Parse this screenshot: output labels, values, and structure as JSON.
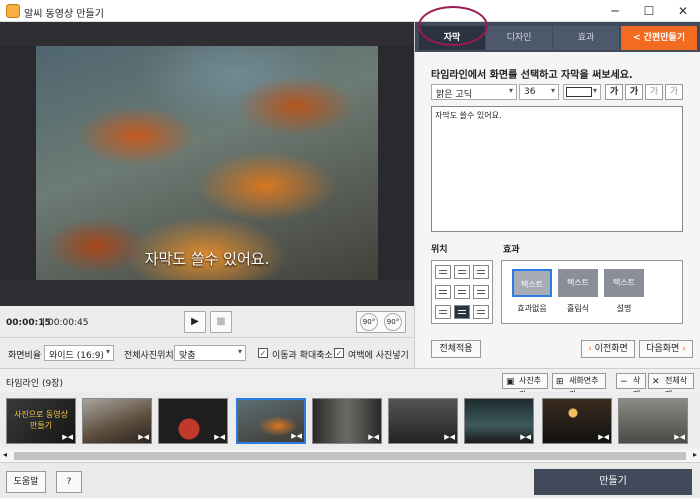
{
  "window": {
    "title": "알씨 동영상 만들기",
    "minimize": "─",
    "maximize": "☐",
    "close": "✕"
  },
  "preview": {
    "caption": "자막도 쓸수 있어요."
  },
  "playback": {
    "current_time": "00:00:15",
    "total_time": "00:00:45",
    "play": "▶",
    "stop": "■",
    "rotate_left": "90°",
    "rotate_right": "90°"
  },
  "settings": {
    "aspect_label": "화면비율",
    "aspect_value": "와이드 (16:9)",
    "position_label": "전체사진위치",
    "position_value": "맞춤",
    "move_zoom_label": "이동과 확대축소",
    "move_zoom_checked": true,
    "margin_label": "여백에 사진넣기",
    "margin_checked": true
  },
  "tabs": [
    {
      "label": "자막"
    },
    {
      "label": "디자인"
    },
    {
      "label": "효과"
    }
  ],
  "quick_make": {
    "icon": "<",
    "label": "간편만들기"
  },
  "subtitle": {
    "instruction": "타임라인에서 화면를 선택하고 자막을 써보세요.",
    "font": "맑은 고딕",
    "size": "36",
    "bold": "가",
    "italic": "가",
    "outline": "가",
    "shadow": "가",
    "text": "자막도 쓸수 있어요.",
    "position_label": "위치",
    "effect_label": "효과",
    "effects": [
      {
        "name": "효과없음",
        "preview": "텍스트"
      },
      {
        "name": "흘림식",
        "preview": "텍스트"
      },
      {
        "name": "설명",
        "preview": "텍스트"
      }
    ],
    "apply_all": "전체적용",
    "prev": "이전화면",
    "next": "다음화면"
  },
  "timeline": {
    "title": "타임라인 (9장)",
    "add_photo": "사진추가",
    "new_screen": "새화면추가",
    "delete": "삭제",
    "delete_all": "전체삭제",
    "first_thumb_text": "사진으로 동영상 만들기"
  },
  "bottom": {
    "help": "도움말",
    "question": "?",
    "make": "만들기"
  }
}
